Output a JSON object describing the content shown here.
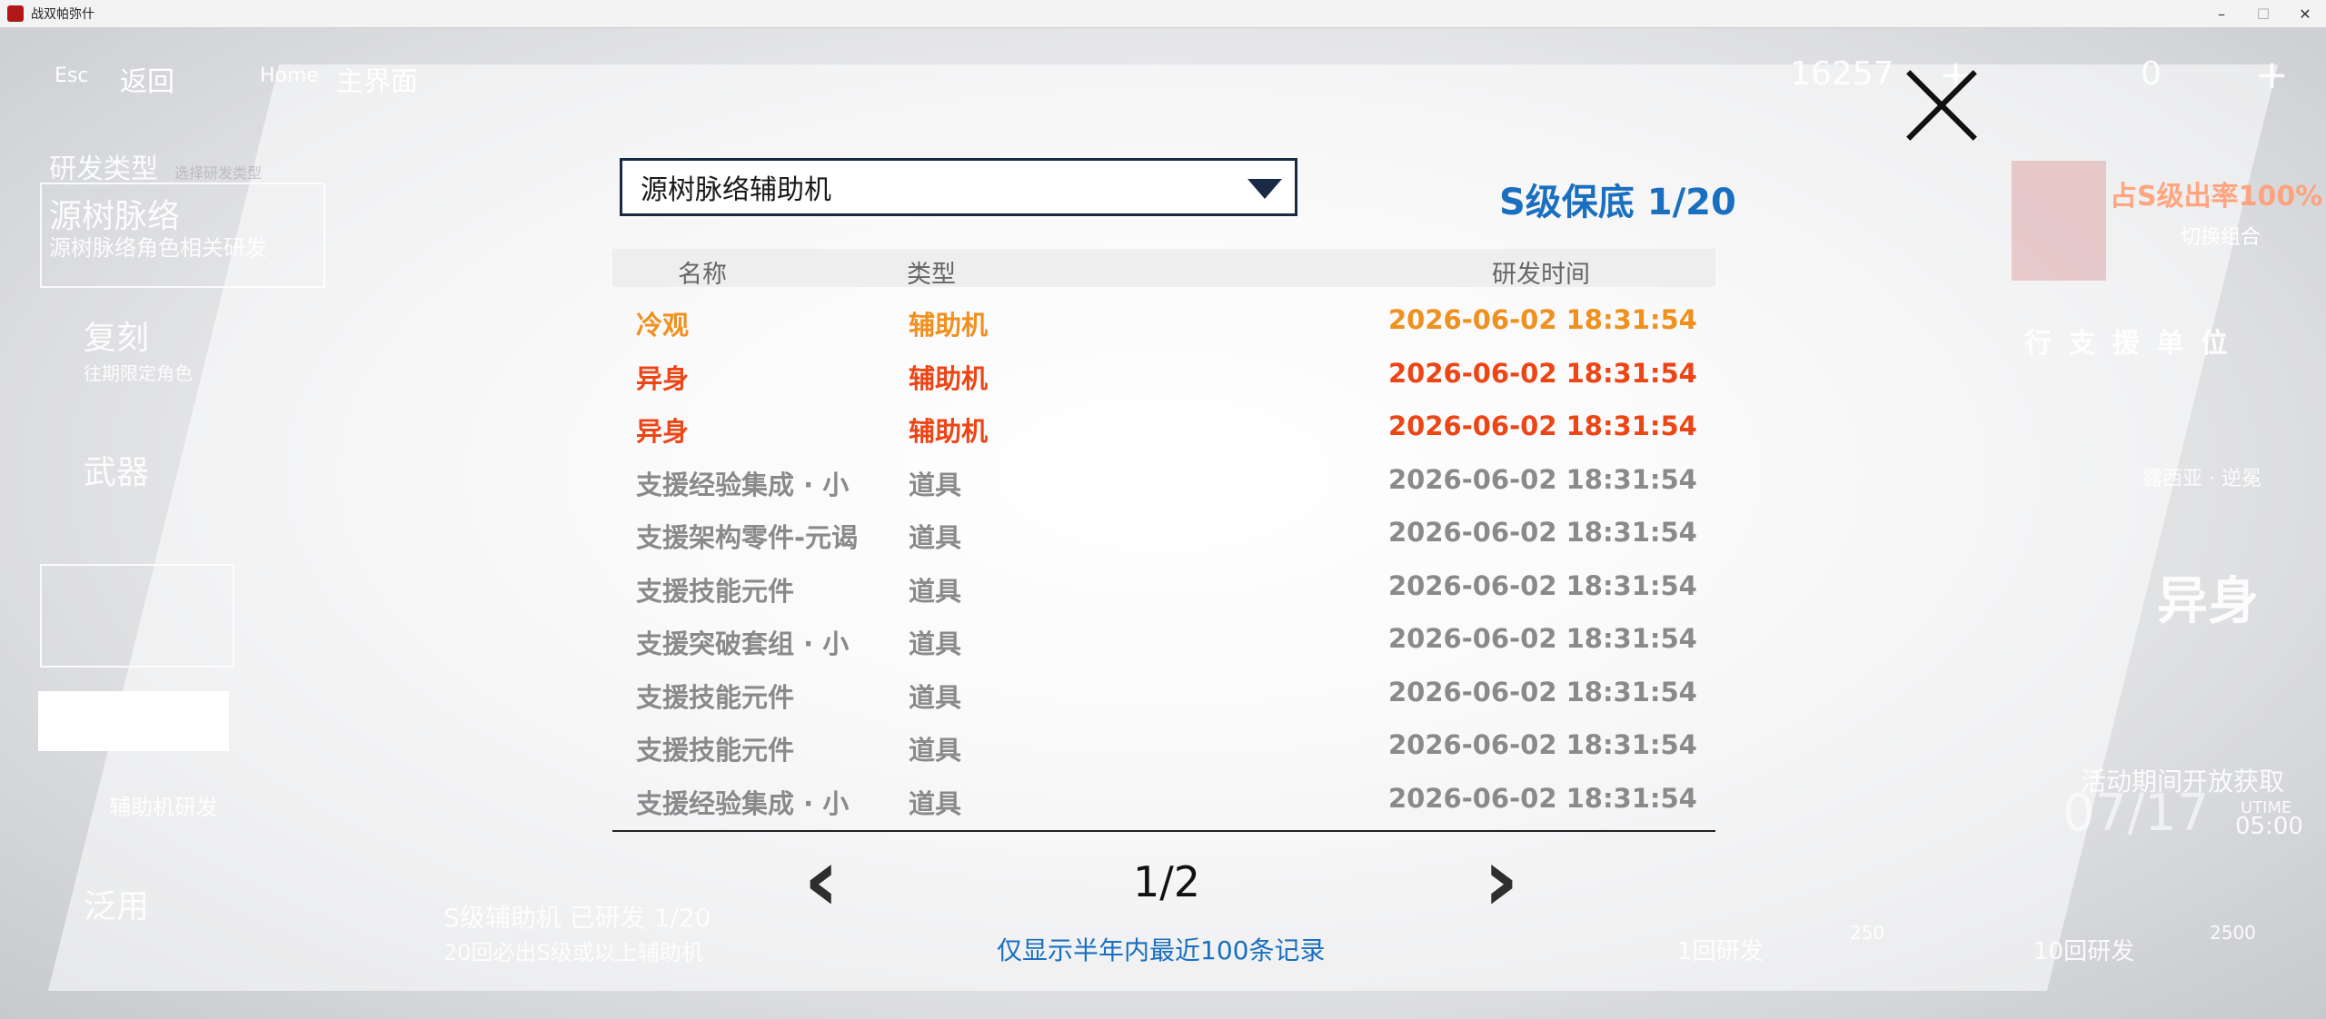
{
  "window": {
    "title": "战双帕弥什",
    "controls": [
      "–",
      "☐",
      "✕"
    ]
  },
  "topnav": {
    "back_key": "Esc",
    "back_label": "返回",
    "home_key": "Home",
    "home_label": "主界面",
    "currency1_value": "16257",
    "currency1_add": "+",
    "currency2_value": "0",
    "currency2_add": "+"
  },
  "background": {
    "dev_type_heading": "研发类型",
    "dev_type_sub": "选择研发类型",
    "tab_active_title": "源树脉络",
    "tab_active_sub": "源树脉络角色相关研发",
    "tab_fuke": "复刻",
    "tab_fuke_sub": "往期限定角色",
    "tab_wuqi": "武器",
    "sidebar_assist": "辅助机研发",
    "tab_fanyong": "泛用",
    "bottom_line1": "S级辅助机  已研发 1/20",
    "bottom_line2": "20回必出S级或以上辅助机",
    "right_rate": "占S级出率100%",
    "right_switch": "切换组合",
    "right_title": "行 支 援 单 位",
    "right_char": "露西亚 · 逆冕",
    "right_big": "异身",
    "right_period": "活动期间开放获取",
    "right_date": "07/17",
    "right_time_label": "UTIME",
    "right_time": "05:00",
    "btn_1": "1回研发",
    "btn_1_cost": "250",
    "btn_10": "10回研发",
    "btn_10_cost": "2500"
  },
  "dialog": {
    "dropdown_value": "源树脉络辅助机",
    "pity": "S级保底 1/20",
    "headers": {
      "name": "名称",
      "type": "类型",
      "time": "研发时间"
    },
    "rows": [
      {
        "name": "冷观",
        "type": "辅助机",
        "time": "2026-06-02 18:31:54",
        "color": "#f0901e"
      },
      {
        "name": "异身",
        "type": "辅助机",
        "time": "2026-06-02 18:31:54",
        "color": "#ec4516"
      },
      {
        "name": "异身",
        "type": "辅助机",
        "time": "2026-06-02 18:31:54",
        "color": "#ec4516"
      },
      {
        "name": "支援经验集成 · 小",
        "type": "道具",
        "time": "2026-06-02 18:31:54",
        "color": "#8a8a8c"
      },
      {
        "name": "支援架构零件-元谒",
        "type": "道具",
        "time": "2026-06-02 18:31:54",
        "color": "#8a8a8c"
      },
      {
        "name": "支援技能元件",
        "type": "道具",
        "time": "2026-06-02 18:31:54",
        "color": "#8a8a8c"
      },
      {
        "name": "支援突破套组 · 小",
        "type": "道具",
        "time": "2026-06-02 18:31:54",
        "color": "#8a8a8c"
      },
      {
        "name": "支援技能元件",
        "type": "道具",
        "time": "2026-06-02 18:31:54",
        "color": "#8a8a8c"
      },
      {
        "name": "支援技能元件",
        "type": "道具",
        "time": "2026-06-02 18:31:54",
        "color": "#8a8a8c"
      },
      {
        "name": "支援经验集成 · 小",
        "type": "道具",
        "time": "2026-06-02 18:31:54",
        "color": "#8a8a8c"
      }
    ],
    "page_indicator": "1/2",
    "prev_icon": "chevron-left-icon",
    "next_icon": "chevron-right-icon",
    "note": "仅显示半年内最近100条记录"
  }
}
